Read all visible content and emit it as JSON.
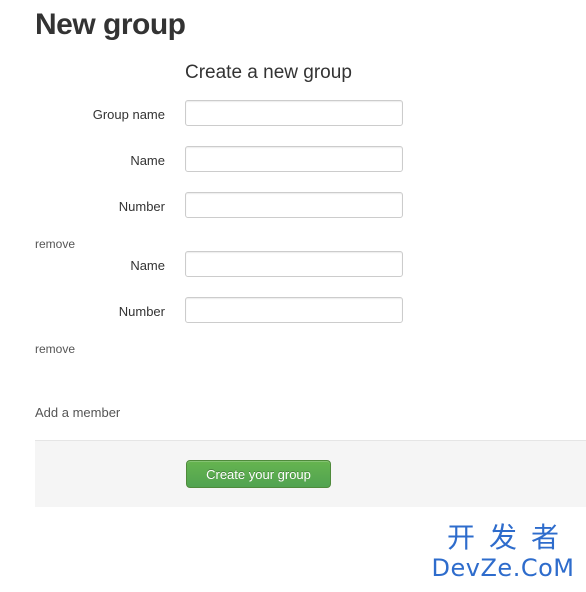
{
  "page": {
    "title": "New group"
  },
  "form": {
    "legend": "Create a new group",
    "group_name": {
      "label": "Group name",
      "value": ""
    },
    "members": [
      {
        "name_label": "Name",
        "name_value": "",
        "number_label": "Number",
        "number_value": "",
        "remove_label": "remove"
      },
      {
        "name_label": "Name",
        "name_value": "",
        "number_label": "Number",
        "number_value": "",
        "remove_label": "remove"
      }
    ],
    "add_member_label": "Add a member",
    "submit_label": "Create your group"
  },
  "watermark": {
    "line1": "开发者",
    "line2": "DevZe.CoM"
  },
  "colors": {
    "button_green": "#5bb75b",
    "actions_bg": "#f5f5f5",
    "watermark_blue": "#2e6ccc"
  }
}
